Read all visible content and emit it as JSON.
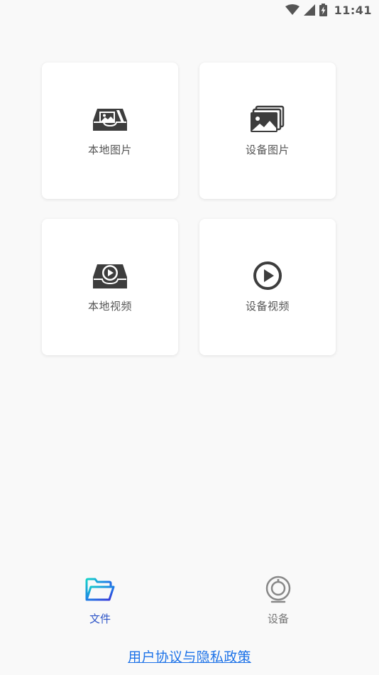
{
  "status_bar": {
    "time": "11:41",
    "icons": [
      "wifi-icon",
      "cell-signal-icon",
      "battery-charging-icon"
    ]
  },
  "cards": [
    {
      "label": "本地图片",
      "icon": "local-image-icon"
    },
    {
      "label": "设备图片",
      "icon": "device-images-icon"
    },
    {
      "label": "本地视频",
      "icon": "local-video-icon"
    },
    {
      "label": "设备视频",
      "icon": "device-video-icon"
    }
  ],
  "bottom_nav": {
    "active_tab": "文件",
    "active_color": "#2f56c8",
    "items": [
      {
        "label": "文件",
        "icon": "folder-icon"
      },
      {
        "label": "设备",
        "icon": "camera-device-icon"
      }
    ]
  },
  "footer": {
    "privacy_link": "用户协议与隐私政策",
    "link_color": "#1e73e8"
  }
}
